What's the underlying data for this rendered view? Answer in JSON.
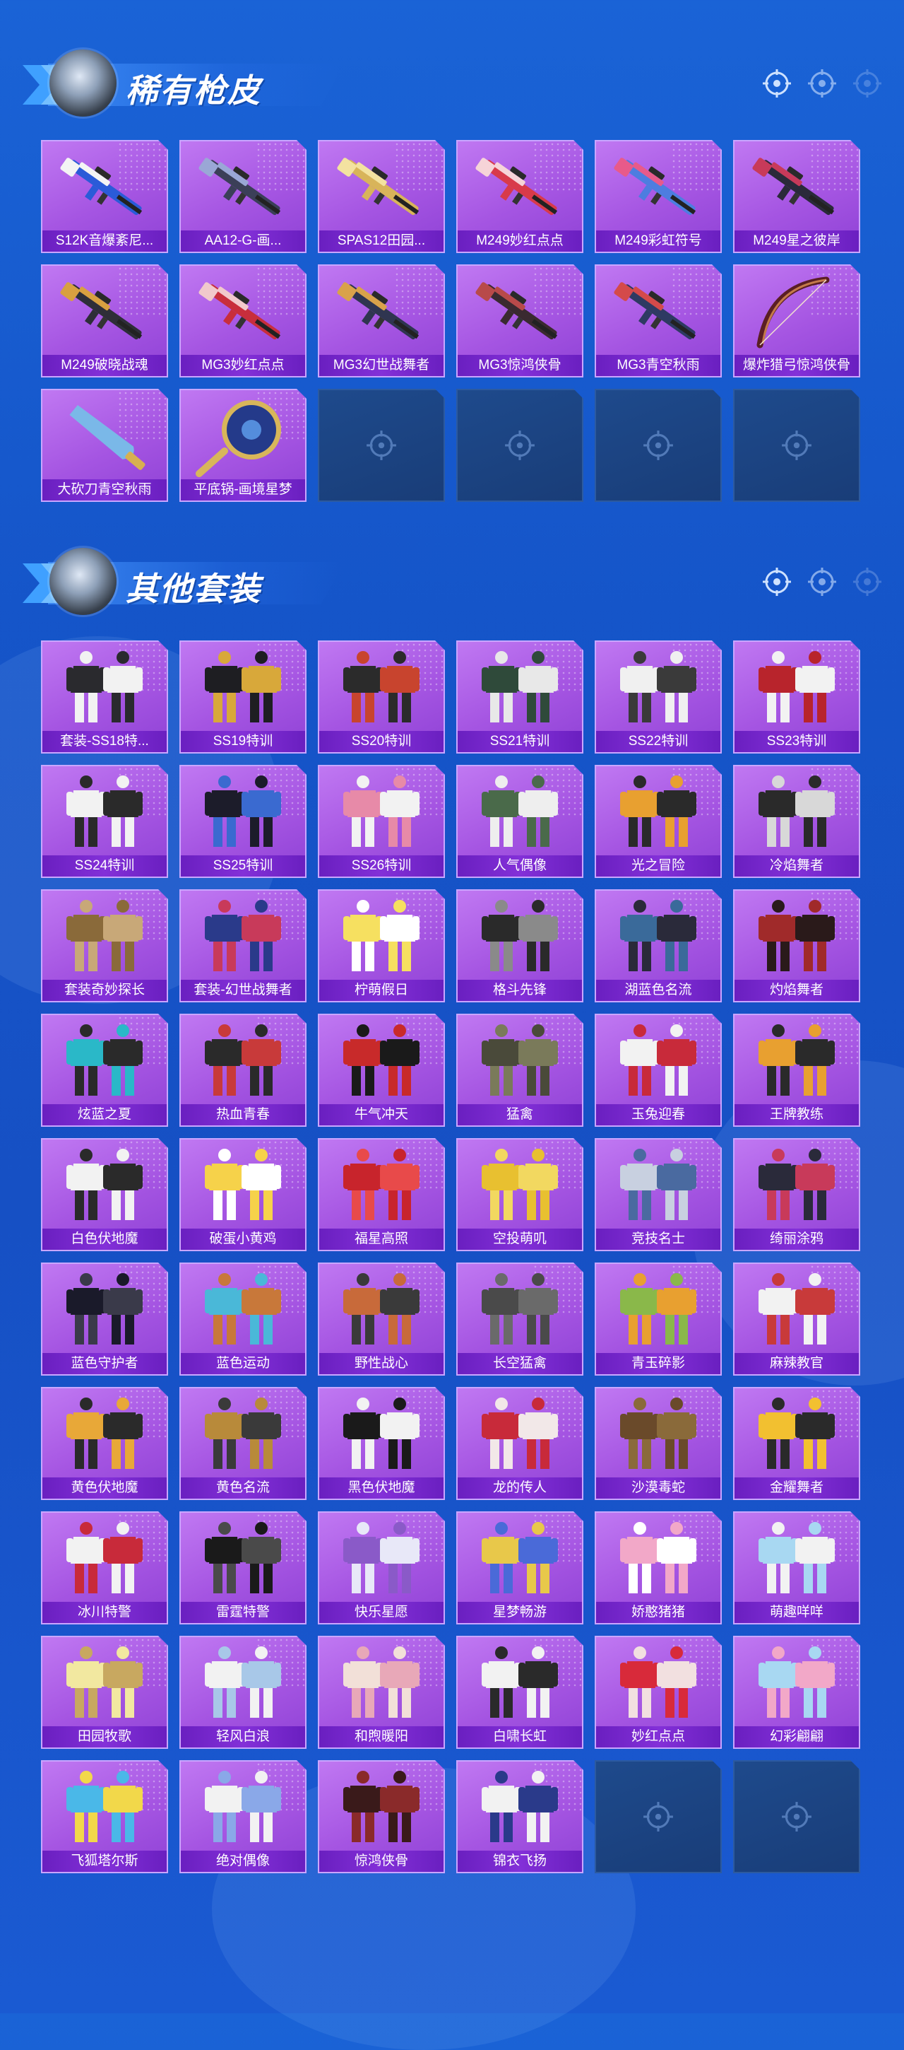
{
  "colors": {
    "page_bg": "#1a5ad2",
    "card_purple": "#a555e2",
    "label_bar": "#7a28d0",
    "empty_slot": "#1e4a8c"
  },
  "sections": [
    {
      "title": "稀有枪皮",
      "items": [
        {
          "label": "S12K音爆紊尼...",
          "kind": "rifle",
          "c1": "#2a5bd8",
          "c2": "#f4f4f4"
        },
        {
          "label": "AA12-G-画...",
          "kind": "rifle",
          "c1": "#3b3f58",
          "c2": "#9aa7d6"
        },
        {
          "label": "SPAS12田园...",
          "kind": "rifle",
          "c1": "#d8b45a",
          "c2": "#f3e2a0"
        },
        {
          "label": "M249妙红点点",
          "kind": "rifle",
          "c1": "#d83a4a",
          "c2": "#f6d4d8"
        },
        {
          "label": "M249彩虹符号",
          "kind": "rifle",
          "c1": "#4d7de0",
          "c2": "#e85a8a"
        },
        {
          "label": "M249星之彼岸",
          "kind": "rifle",
          "c1": "#2a2a3a",
          "c2": "#c83a5a"
        },
        {
          "label": "M249破晓战魂",
          "kind": "rifle",
          "c1": "#2e2e38",
          "c2": "#d8a040"
        },
        {
          "label": "MG3妙红点点",
          "kind": "rifle",
          "c1": "#c82e3c",
          "c2": "#f1c9cc"
        },
        {
          "label": "MG3幻世战舞者",
          "kind": "rifle",
          "c1": "#2f3550",
          "c2": "#d9a24a"
        },
        {
          "label": "MG3惊鸿侠骨",
          "kind": "rifle",
          "c1": "#3a2a30",
          "c2": "#b84a4a"
        },
        {
          "label": "MG3青空秋雨",
          "kind": "rifle",
          "c1": "#2e3a62",
          "c2": "#d44a4a"
        },
        {
          "label": "爆炸猎弓惊鸿侠骨",
          "kind": "bow",
          "c1": "#5a1e24",
          "c2": "#c47a4a"
        },
        {
          "label": "大砍刀青空秋雨",
          "kind": "blade",
          "c1": "#7ab8e8",
          "c2": "#d8b050"
        },
        {
          "label": "平底锅-画境星梦",
          "kind": "pan",
          "c1": "#243a8a",
          "c2": "#d8b65a"
        },
        {
          "label": "",
          "kind": "empty"
        },
        {
          "label": "",
          "kind": "empty"
        },
        {
          "label": "",
          "kind": "empty"
        },
        {
          "label": "",
          "kind": "empty"
        }
      ]
    },
    {
      "title": "其他套装",
      "items": [
        {
          "label": "套装-SS18特...",
          "kind": "outfit",
          "c1": "#2a2a2e",
          "c2": "#f2f2f2"
        },
        {
          "label": "SS19特训",
          "kind": "outfit",
          "c1": "#1e1e22",
          "c2": "#d8a83a"
        },
        {
          "label": "SS20特训",
          "kind": "outfit",
          "c1": "#2b2b2b",
          "c2": "#c8442e"
        },
        {
          "label": "SS21特训",
          "kind": "outfit",
          "c1": "#2f4a3a",
          "c2": "#e8e8e8"
        },
        {
          "label": "SS22特训",
          "kind": "outfit",
          "c1": "#f0f0f0",
          "c2": "#3a3a3a"
        },
        {
          "label": "SS23特训",
          "kind": "outfit",
          "c1": "#b8242c",
          "c2": "#f2f2f2"
        },
        {
          "label": "SS24特训",
          "kind": "outfit",
          "c1": "#f2f2f2",
          "c2": "#2a2a2a"
        },
        {
          "label": "SS25特训",
          "kind": "outfit",
          "c1": "#1c1c2a",
          "c2": "#3a6ad0"
        },
        {
          "label": "SS26特训",
          "kind": "outfit",
          "c1": "#e78aa8",
          "c2": "#f2f2f2"
        },
        {
          "label": "人气偶像",
          "kind": "outfit",
          "c1": "#4a6a4a",
          "c2": "#eeeeee"
        },
        {
          "label": "光之冒险",
          "kind": "outfit",
          "c1": "#e8a030",
          "c2": "#2a2a2a"
        },
        {
          "label": "冷焰舞者",
          "kind": "outfit",
          "c1": "#2a2a2a",
          "c2": "#d8d8d8"
        },
        {
          "label": "套装奇妙探长",
          "kind": "outfit",
          "c1": "#8a6a3a",
          "c2": "#c8a878"
        },
        {
          "label": "套装-幻世战舞者",
          "kind": "outfit",
          "c1": "#2a3a8a",
          "c2": "#c83a5a"
        },
        {
          "label": "柠萌假日",
          "kind": "outfit",
          "c1": "#f6e060",
          "c2": "#ffffff"
        },
        {
          "label": "格斗先锋",
          "kind": "outfit",
          "c1": "#2a2a2a",
          "c2": "#8a8a8a"
        },
        {
          "label": "湖蓝色名流",
          "kind": "outfit",
          "c1": "#3a6a9a",
          "c2": "#2a2a3a"
        },
        {
          "label": "灼焰舞者",
          "kind": "outfit",
          "c1": "#a02a2a",
          "c2": "#2a1a1a"
        },
        {
          "label": "炫蓝之夏",
          "kind": "outfit",
          "c1": "#2ab8c8",
          "c2": "#2a2a2a"
        },
        {
          "label": "热血青春",
          "kind": "outfit",
          "c1": "#2a2a2a",
          "c2": "#c83a3a"
        },
        {
          "label": "牛气冲天",
          "kind": "outfit",
          "c1": "#c82a2a",
          "c2": "#1a1a1a"
        },
        {
          "label": "猛禽",
          "kind": "outfit",
          "c1": "#4a4a3a",
          "c2": "#7a7a5a"
        },
        {
          "label": "玉兔迎春",
          "kind": "outfit",
          "c1": "#f2f2f2",
          "c2": "#c82a3a"
        },
        {
          "label": "王牌教练",
          "kind": "outfit",
          "c1": "#e8a030",
          "c2": "#2a2a2a"
        },
        {
          "label": "白色伏地魔",
          "kind": "outfit",
          "c1": "#f2f2f2",
          "c2": "#2a2a2a"
        },
        {
          "label": "破蛋小黄鸡",
          "kind": "outfit",
          "c1": "#f6d24a",
          "c2": "#ffffff"
        },
        {
          "label": "福星高照",
          "kind": "outfit",
          "c1": "#c8242c",
          "c2": "#e84a4a"
        },
        {
          "label": "空投萌叽",
          "kind": "outfit",
          "c1": "#e8c030",
          "c2": "#f2d860"
        },
        {
          "label": "竞技名士",
          "kind": "outfit",
          "c1": "#c8d0e0",
          "c2": "#4a6aa0"
        },
        {
          "label": "绮丽涂鸦",
          "kind": "outfit",
          "c1": "#2a2a3a",
          "c2": "#c83a5a"
        },
        {
          "label": "蓝色守护者",
          "kind": "outfit",
          "c1": "#1a1a2a",
          "c2": "#3a3a4a"
        },
        {
          "label": "蓝色运动",
          "kind": "outfit",
          "c1": "#4ab8d8",
          "c2": "#c8783a"
        },
        {
          "label": "野性战心",
          "kind": "outfit",
          "c1": "#c86a3a",
          "c2": "#3a3a3a"
        },
        {
          "label": "长空猛禽",
          "kind": "outfit",
          "c1": "#4a4a4a",
          "c2": "#6a6a6a"
        },
        {
          "label": "青玉碎影",
          "kind": "outfit",
          "c1": "#8ab84a",
          "c2": "#e8a030"
        },
        {
          "label": "麻辣教官",
          "kind": "outfit",
          "c1": "#f2f2f2",
          "c2": "#c83a3a"
        },
        {
          "label": "黄色伏地魔",
          "kind": "outfit",
          "c1": "#e8a838",
          "c2": "#2a2a2a"
        },
        {
          "label": "黄色名流",
          "kind": "outfit",
          "c1": "#b88a3a",
          "c2": "#3a3a3a"
        },
        {
          "label": "黑色伏地魔",
          "kind": "outfit",
          "c1": "#1a1a1a",
          "c2": "#f2f2f2"
        },
        {
          "label": "龙的传人",
          "kind": "outfit",
          "c1": "#c82a3a",
          "c2": "#f2e8e8"
        },
        {
          "label": "沙漠毒蛇",
          "kind": "outfit",
          "c1": "#6a4a2a",
          "c2": "#8a6a3a"
        },
        {
          "label": "金耀舞者",
          "kind": "outfit",
          "c1": "#f2c030",
          "c2": "#2a2a2a"
        },
        {
          "label": "冰川特警",
          "kind": "outfit",
          "c1": "#f2f2f2",
          "c2": "#c82a3a"
        },
        {
          "label": "雷霆特警",
          "kind": "outfit",
          "c1": "#1a1a1a",
          "c2": "#4a4a4a"
        },
        {
          "label": "快乐星愿",
          "kind": "outfit",
          "c1": "#8a5ac8",
          "c2": "#e8e8f8"
        },
        {
          "label": "星梦畅游",
          "kind": "outfit",
          "c1": "#e8c84a",
          "c2": "#4a6ad8"
        },
        {
          "label": "娇憨猪猪",
          "kind": "outfit",
          "c1": "#f2a8c8",
          "c2": "#ffffff"
        },
        {
          "label": "萌趣咩咩",
          "kind": "outfit",
          "c1": "#a8d8f2",
          "c2": "#f2f2f2"
        },
        {
          "label": "田园牧歌",
          "kind": "outfit",
          "c1": "#f2e8a0",
          "c2": "#c8a860"
        },
        {
          "label": "轻风白浪",
          "kind": "outfit",
          "c1": "#f2f2f2",
          "c2": "#a8c8e8"
        },
        {
          "label": "和煦暖阳",
          "kind": "outfit",
          "c1": "#f2e0d8",
          "c2": "#e8a8b8"
        },
        {
          "label": "白啸长虹",
          "kind": "outfit",
          "c1": "#f2f2f2",
          "c2": "#2a2a2a"
        },
        {
          "label": "妙红点点",
          "kind": "outfit",
          "c1": "#d82a3a",
          "c2": "#f2e0e0"
        },
        {
          "label": "幻彩翩翩",
          "kind": "outfit",
          "c1": "#a8d8f2",
          "c2": "#f2a8c8"
        },
        {
          "label": "飞狐塔尔斯",
          "kind": "outfit",
          "c1": "#4ab8e8",
          "c2": "#f2d84a"
        },
        {
          "label": "绝对偶像",
          "kind": "outfit",
          "c1": "#f2f2f2",
          "c2": "#8aa8e8"
        },
        {
          "label": "惊鸿侠骨",
          "kind": "outfit",
          "c1": "#3a1a1a",
          "c2": "#8a2a2a"
        },
        {
          "label": "锦衣飞扬",
          "kind": "outfit",
          "c1": "#f2f2f2",
          "c2": "#2a3a8a"
        },
        {
          "label": "",
          "kind": "empty"
        },
        {
          "label": "",
          "kind": "empty"
        }
      ]
    }
  ]
}
